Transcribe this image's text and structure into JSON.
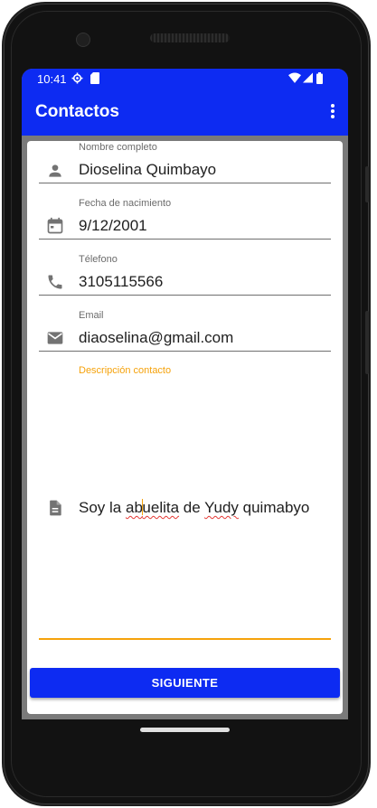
{
  "status_bar": {
    "time": "10:41",
    "icons": [
      "settings-gear-icon",
      "sim-card-icon",
      "wifi-icon",
      "signal-icon",
      "battery-icon"
    ]
  },
  "app_bar": {
    "title": "Contactos",
    "menu_icon": "more-vert-icon"
  },
  "form": {
    "fields": [
      {
        "label": "Nombre completo",
        "value": "Dioselina Quimbayo",
        "icon": "person-icon"
      },
      {
        "label": "Fecha de nacimiento",
        "value": "9/12/2001",
        "icon": "calendar-icon"
      },
      {
        "label": "Télefono",
        "value": "3105115566",
        "icon": "phone-icon"
      },
      {
        "label": "Email",
        "value": "diaoselina@gmail.com",
        "icon": "email-icon"
      }
    ],
    "description": {
      "label": "Descripción contacto",
      "icon": "description-icon",
      "parts": {
        "p1": "Soy la ",
        "w1a": "ab",
        "w1b": "uelita",
        "p2": " de ",
        "w2": "Yudy",
        "p3": " quimabyo"
      }
    },
    "submit_label": "SIGUIENTE"
  },
  "colors": {
    "primary": "#0d2bf2",
    "accent": "#f5a20b",
    "spell_error": "#e53935"
  }
}
